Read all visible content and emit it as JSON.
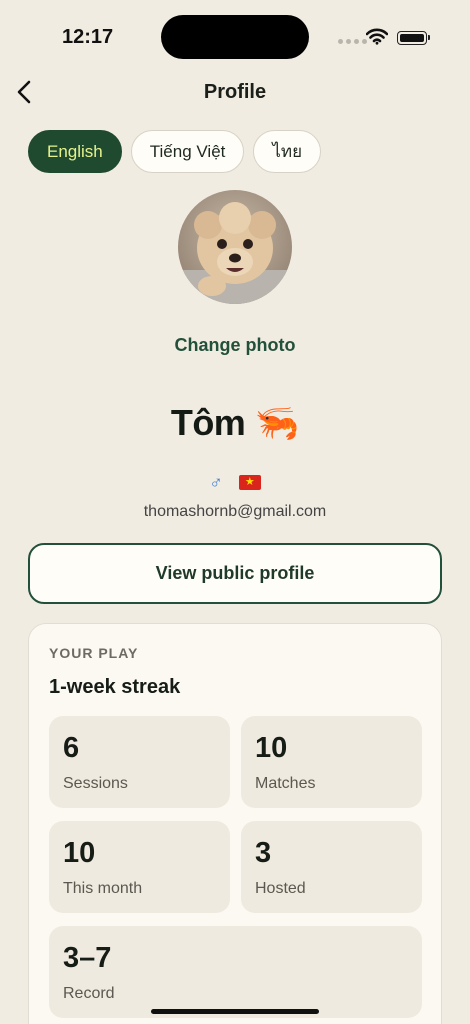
{
  "status_bar": {
    "time": "12:17"
  },
  "nav": {
    "title": "Profile"
  },
  "languages": [
    {
      "label": "English",
      "active": true
    },
    {
      "label": "Tiếng Việt",
      "active": false
    },
    {
      "label": "ไทย",
      "active": false
    }
  ],
  "profile": {
    "change_photo": "Change photo",
    "name": "Tôm 🦐",
    "gender_symbol": "♂",
    "flag_star": "★",
    "email": "thomashornb@gmail.com",
    "view_public_profile": "View public profile"
  },
  "play": {
    "eyebrow": "YOUR PLAY",
    "streak": "1-week streak",
    "stats": [
      {
        "value": "6",
        "label": "Sessions"
      },
      {
        "value": "10",
        "label": "Matches"
      },
      {
        "value": "10",
        "label": "This month"
      },
      {
        "value": "3",
        "label": "Hosted"
      },
      {
        "value": "3–7",
        "label": "Record"
      }
    ]
  },
  "colors": {
    "background": "#f1ece2",
    "accent": "#1f4a30",
    "accent_text": "#e5f28c",
    "link": "#23503a"
  }
}
